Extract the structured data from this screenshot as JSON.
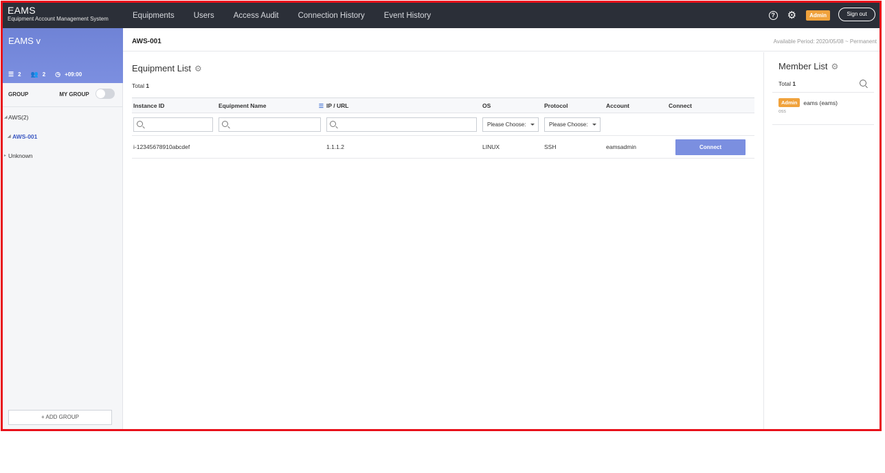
{
  "app": {
    "title": "EAMS",
    "subtitle": "Equipment Account Management System"
  },
  "nav": [
    "Equipments",
    "Users",
    "Access Audit",
    "Connection History",
    "Event History"
  ],
  "header": {
    "help_icon": "?",
    "role_badge": "Admin",
    "signout_label": "Sign out"
  },
  "sidebar": {
    "title": "EAMS v",
    "stats": {
      "groups": "2",
      "users": "2",
      "timezone": "+09:00"
    },
    "group_label": "GROUP",
    "my_group_label": "MY GROUP",
    "tree": [
      {
        "label": "AWS(2)"
      },
      {
        "label": "AWS-001"
      },
      {
        "label": "Unknown"
      }
    ],
    "add_group_label": "ADD GROUP"
  },
  "breadcrumb": "AWS-001",
  "available_period": "Available Period: 2020/05/08 ~ Permanent",
  "equipment": {
    "title": "Equipment List",
    "total_label": "Total",
    "total_value": "1",
    "columns": [
      "Instance ID",
      "Equipment Name",
      "IP / URL",
      "OS",
      "Protocol",
      "Account",
      "Connect"
    ],
    "os_filter": "Please Choose:",
    "protocol_filter": "Please Choose:",
    "rows": [
      {
        "instance_id": "i-12345678910abcdef",
        "name": "",
        "ip": "1.1.1.2",
        "os": "LINUX",
        "protocol": "SSH",
        "account": "eamsadmin",
        "connect_label": "Connect"
      }
    ]
  },
  "members": {
    "title": "Member List",
    "total_label": "Total",
    "total_value": "1",
    "items": [
      {
        "badge": "Admin",
        "name": "eams (eams)",
        "org": "oss"
      }
    ]
  },
  "colors": {
    "accent": "#7b8fe0",
    "badge": "#f0a23c",
    "topbar": "#2b2f38",
    "frame": "#e8101a"
  }
}
